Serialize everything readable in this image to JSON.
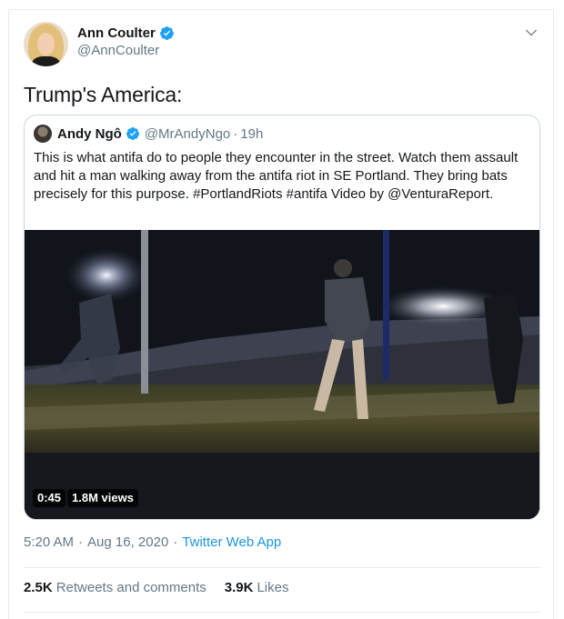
{
  "author": {
    "display_name": "Ann Coulter",
    "handle": "@AnnCoulter",
    "verified": true,
    "avatar_icon": "profile-photo"
  },
  "tweet_text": "Trump's America:",
  "quoted": {
    "display_name": "Andy Ngô",
    "handle": "@MrAndyNgo",
    "separator": "·",
    "time": "19h",
    "text": "This is what antifa do to people they encounter in the street. Watch them assault and hit a man walking away from the antifa riot in SE Portland. They bring bats precisely for this purpose. #PortlandRiots #antifa Video by @VenturaReport.",
    "video": {
      "duration": "0:45",
      "views": "1.8M views"
    }
  },
  "meta": {
    "time": "5:20 AM",
    "separator": "·",
    "date": "Aug 16, 2020",
    "separator2": "·",
    "source": "Twitter Web App"
  },
  "stats": {
    "retweets_count": "2.5K",
    "retweets_label": "Retweets and comments",
    "likes_count": "3.9K",
    "likes_label": "Likes"
  },
  "colors": {
    "verified": "#1da1f2",
    "link": "#1b95e0",
    "secondary_text": "#657786"
  }
}
